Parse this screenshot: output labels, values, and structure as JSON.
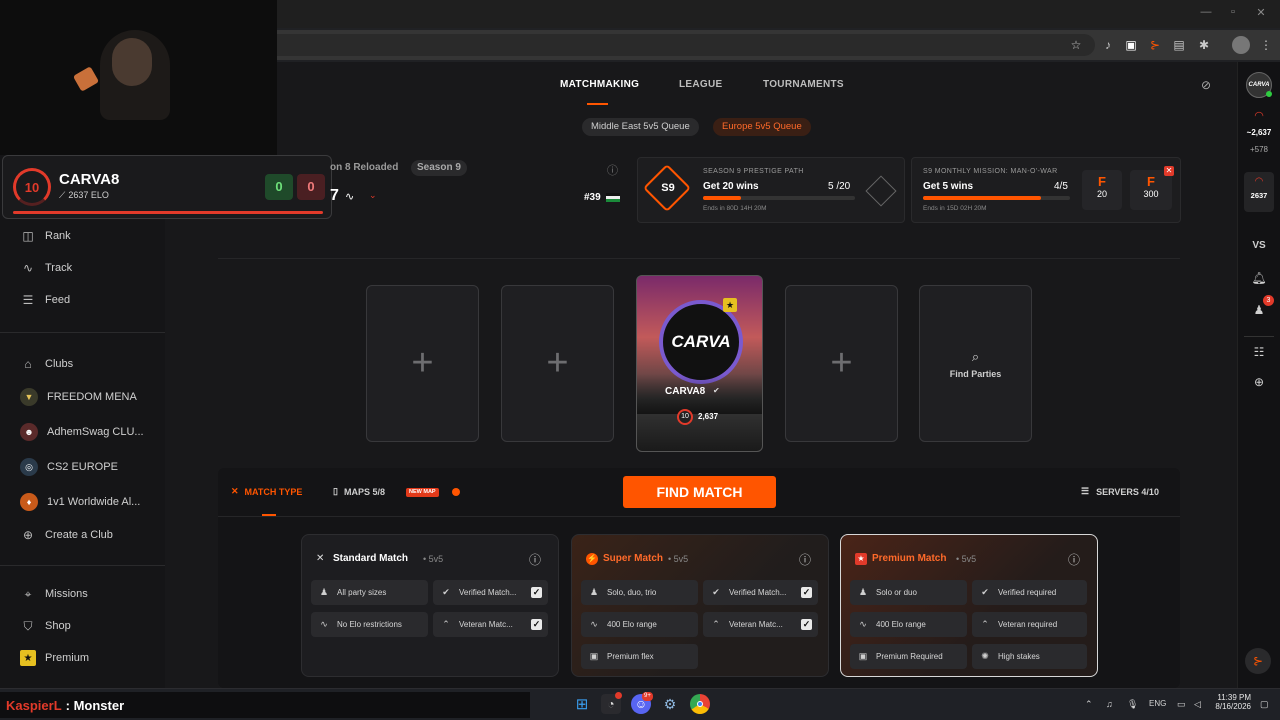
{
  "browser": {
    "url": ""
  },
  "nav": {
    "tabs": [
      "MATCHMAKING",
      "LEAGUE",
      "TOURNAMENTS"
    ]
  },
  "queues": {
    "middle_east": "Middle East 5v5 Queue",
    "europe": "Europe 5v5 Queue"
  },
  "season": {
    "name_fragment": "on 8 Reloaded",
    "season_label": "Season 9",
    "elo_fragment": "7",
    "rank": "#39"
  },
  "prestige": {
    "heading": "SEASON 9 PRESTIGE PATH",
    "badge": "S9",
    "goal": "Get 20 wins",
    "progress_text": "5 /20",
    "progress": 0.25,
    "ends": "Ends in 80D 14H 20M"
  },
  "monthly": {
    "heading": "S9 MONTHLY MISSION: MAN-O'-WAR",
    "goal": "Get 5 wins",
    "progress_text": "4/5",
    "progress": 0.8,
    "ends": "Ends in 15D 02H 20M",
    "reward1": "20",
    "reward2": "300",
    "reward_letter": "F"
  },
  "overlay": {
    "level": "10",
    "name": "CARVA8",
    "elo": "2637 ELO",
    "wins": "0",
    "losses": "0"
  },
  "sidebar": {
    "top_items": [
      {
        "label": "Rank",
        "icon": "rank-icon"
      },
      {
        "label": "Track",
        "icon": "track-icon"
      },
      {
        "label": "Feed",
        "icon": "feed-icon"
      }
    ],
    "clubs_label": "Clubs",
    "clubs": [
      "FREEDOM MENA",
      "AdhemSwag CLU...",
      "CS2 EUROPE",
      "1v1 Worldwide Al..."
    ],
    "create_club": "Create a Club",
    "bottom_items": [
      {
        "label": "Missions",
        "icon": "missions-icon"
      },
      {
        "label": "Shop",
        "icon": "shop-icon"
      },
      {
        "label": "Premium",
        "icon": "premium-icon"
      }
    ]
  },
  "party": {
    "player_name": "CARVA8",
    "player_logo": "CARVA",
    "player_level": "10",
    "player_elo": "2,637",
    "find_parties": "Find Parties"
  },
  "match_bar": {
    "match_type": "MATCH TYPE",
    "maps": "MAPS 5/8",
    "new_map": "NEW MAP",
    "find_match": "FIND MATCH",
    "servers": "SERVERS 4/10"
  },
  "modes": [
    {
      "title": "Standard Match",
      "size": "• 5v5",
      "options": [
        {
          "label": "All party sizes",
          "icon": "party-icon",
          "check": false
        },
        {
          "label": "Verified Match...",
          "icon": "verified-icon",
          "check": true
        },
        {
          "label": "No Elo restrictions",
          "icon": "elo-icon",
          "check": false
        },
        {
          "label": "Veteran Matc...",
          "icon": "veteran-icon",
          "check": true
        }
      ]
    },
    {
      "title": "Super Match",
      "size": "• 5v5",
      "options": [
        {
          "label": "Solo, duo, trio",
          "icon": "party-icon",
          "check": false
        },
        {
          "label": "Verified Match...",
          "icon": "verified-icon",
          "check": true
        },
        {
          "label": "400 Elo range",
          "icon": "elo-icon",
          "check": false
        },
        {
          "label": "Veteran Matc...",
          "icon": "veteran-icon",
          "check": true
        },
        {
          "label": "Premium flex",
          "icon": "premium-icon",
          "check": false
        }
      ]
    },
    {
      "title": "Premium Match",
      "size": "• 5v5",
      "options": [
        {
          "label": "Solo or duo",
          "icon": "party-icon",
          "check": false
        },
        {
          "label": "Verified required",
          "icon": "verified-icon",
          "check": false
        },
        {
          "label": "400 Elo range",
          "icon": "elo-icon",
          "check": false
        },
        {
          "label": "Veteran required",
          "icon": "veteran-icon",
          "check": false
        },
        {
          "label": "Premium Required",
          "icon": "premium-icon",
          "check": false
        },
        {
          "label": "High stakes",
          "icon": "stakes-icon",
          "check": false
        }
      ]
    }
  ],
  "rightbar": {
    "logo": "CARVA",
    "elo": "~2,637",
    "delta": "+578",
    "elo2": "2637",
    "vs": "VS",
    "friend_badge": "3"
  },
  "taskbar": {
    "streamer": "KaspierL",
    "song": ": Monster",
    "lang": "ENG",
    "time": "11:39 PM",
    "date": "8/16/2026",
    "discord_badge": "9+"
  },
  "colors": {
    "accent": "#ff5500",
    "bg": "#18181a"
  }
}
